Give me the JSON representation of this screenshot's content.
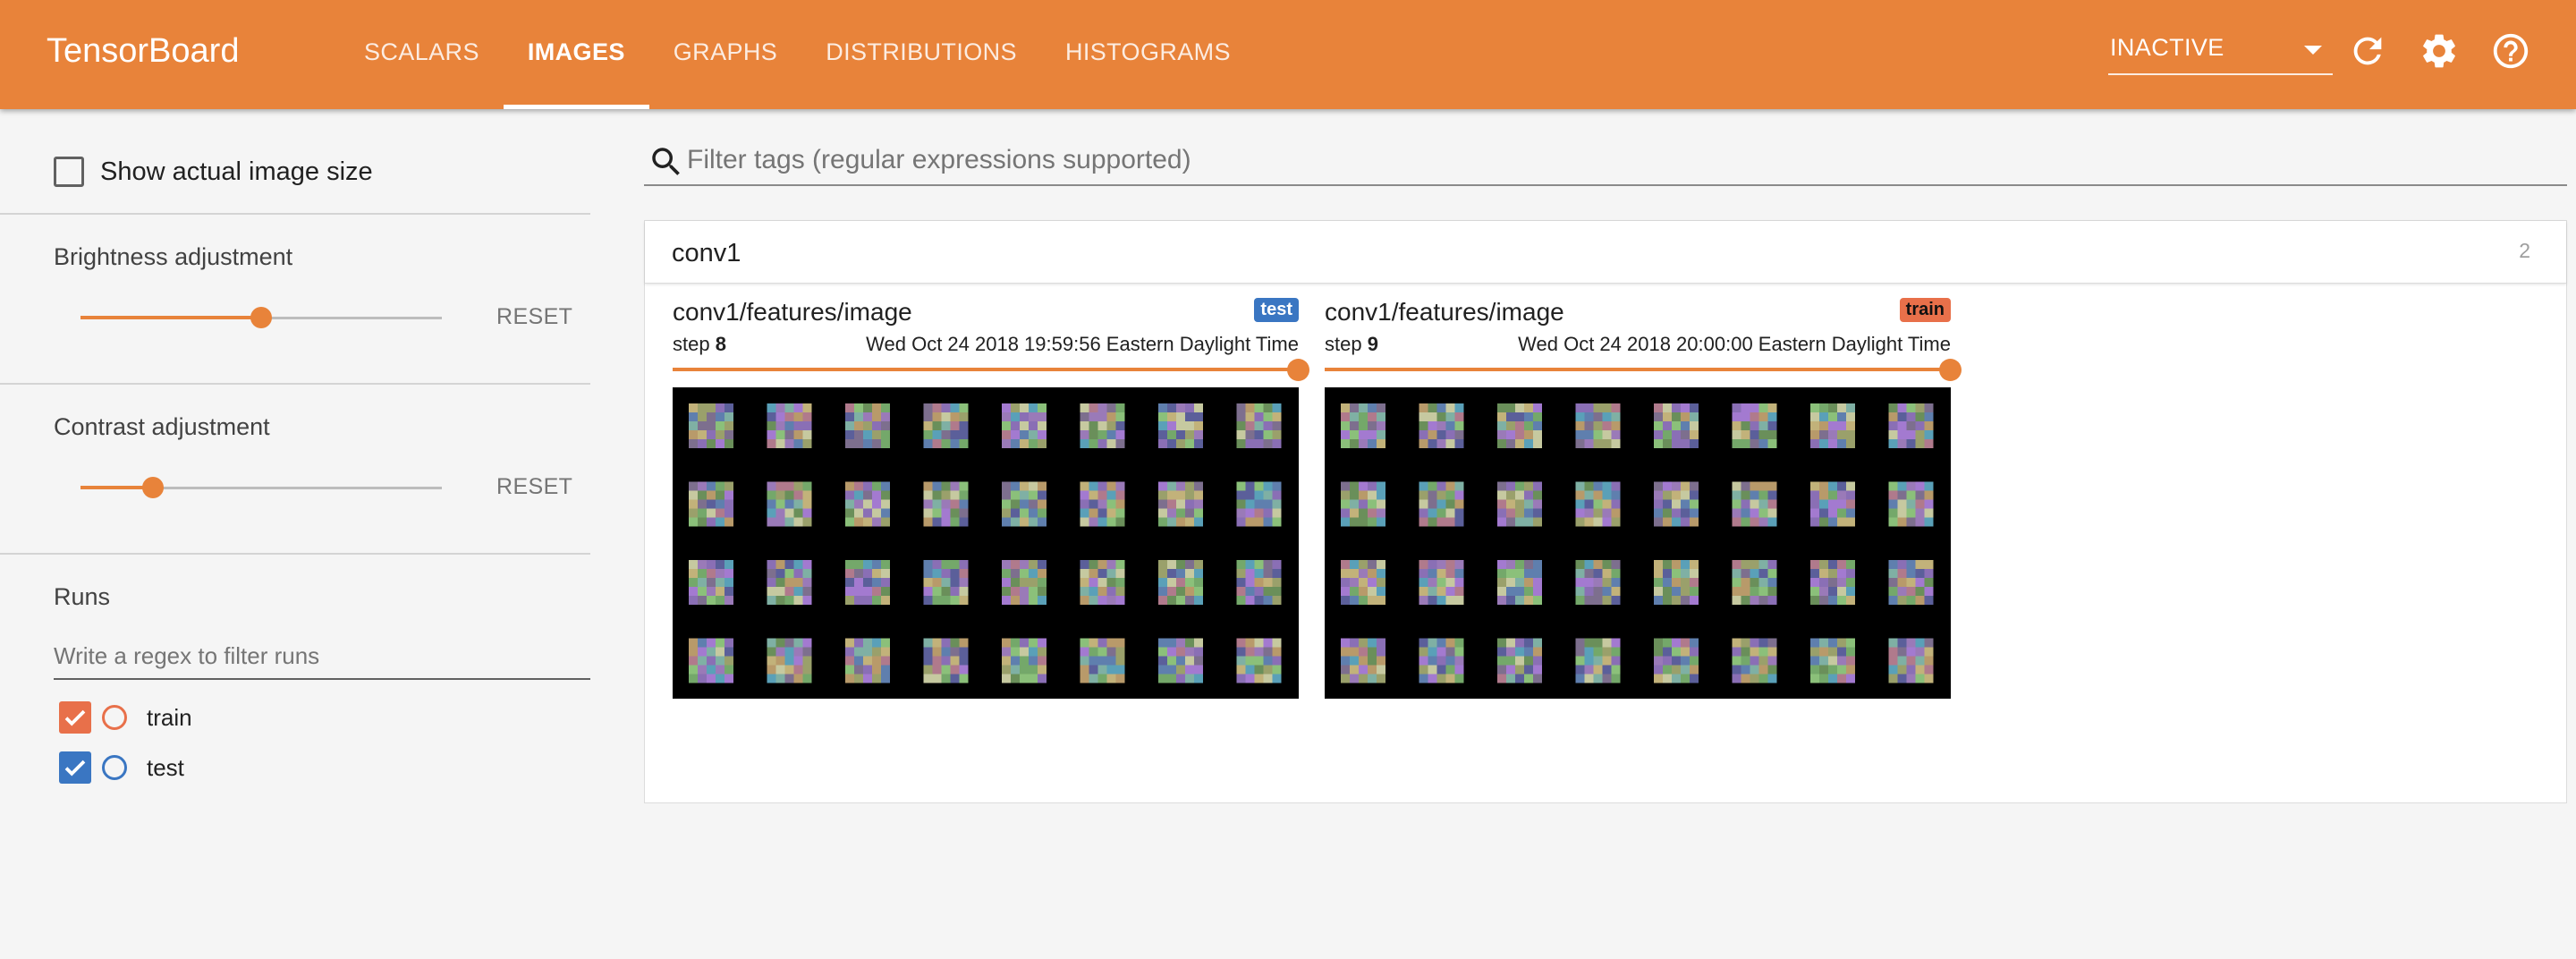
{
  "app": {
    "title": "TensorBoard",
    "accent_color": "#e8833a"
  },
  "nav": {
    "tabs": [
      {
        "label": "SCALARS",
        "active": false
      },
      {
        "label": "IMAGES",
        "active": true
      },
      {
        "label": "GRAPHS",
        "active": false
      },
      {
        "label": "DISTRIBUTIONS",
        "active": false
      },
      {
        "label": "HISTOGRAMS",
        "active": false
      }
    ],
    "run_selector": {
      "value": "INACTIVE",
      "icon": "chevron-down-icon"
    },
    "icons": [
      "refresh-icon",
      "settings-gear-icon",
      "help-icon"
    ]
  },
  "sidebar": {
    "show_actual_size": {
      "label": "Show actual image size",
      "checked": false
    },
    "brightness": {
      "title": "Brightness adjustment",
      "value": 0.5,
      "reset_label": "RESET"
    },
    "contrast": {
      "title": "Contrast adjustment",
      "value": 0.2,
      "reset_label": "RESET"
    },
    "runs": {
      "title": "Runs",
      "filter_placeholder": "Write a regex to filter runs",
      "items": [
        {
          "name": "train",
          "checked": true,
          "color": "#e8704a"
        },
        {
          "name": "test",
          "checked": true,
          "color": "#3a76c2"
        }
      ]
    }
  },
  "main": {
    "search": {
      "placeholder": "Filter tags (regular expressions supported)",
      "icon": "search-icon"
    },
    "card": {
      "title": "conv1",
      "count": "2",
      "panels": [
        {
          "tag": "conv1/features/image",
          "run": "test",
          "run_color": "#3a76c2",
          "step_label": "step",
          "step": "8",
          "timestamp": "Wed Oct 24 2018 19:59:56 Eastern Daylight Time",
          "step_position": 1.0
        },
        {
          "tag": "conv1/features/image",
          "run": "train",
          "run_color": "#e8704a",
          "step_label": "step",
          "step": "9",
          "timestamp": "Wed Oct 24 2018 20:00:00 Eastern Daylight Time",
          "step_position": 1.0
        }
      ]
    }
  }
}
